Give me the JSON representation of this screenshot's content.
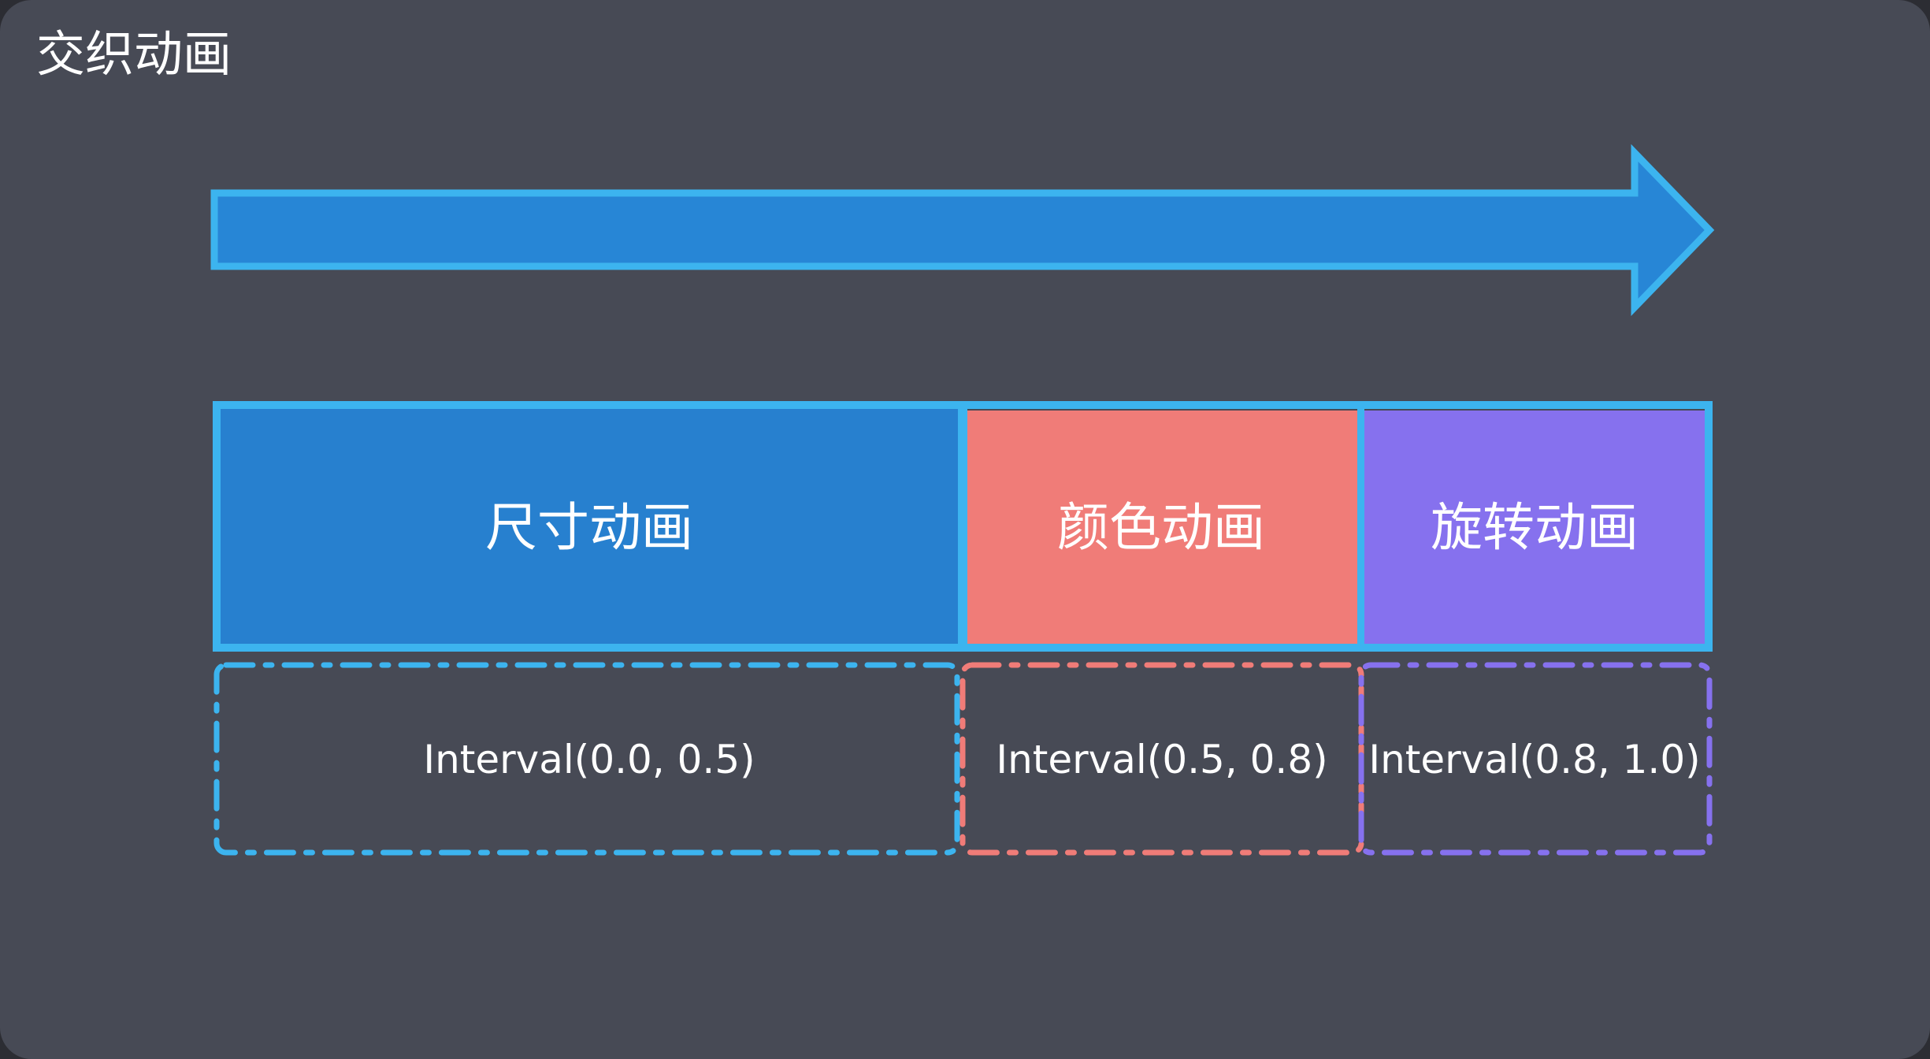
{
  "title": "交织动画",
  "colors": {
    "background": "#474a55",
    "arrow_fill": "#2786d6",
    "arrow_border": "#3cb4ef",
    "size_fill": "#2780cf",
    "color_fill": "#f07c78",
    "rotate_fill": "#8671ee",
    "frame_border": "#3cb4ef",
    "size_dash": "#3cb4ef",
    "color_dash": "#f07c78",
    "rotate_dash": "#8671ee"
  },
  "segments": [
    {
      "label": "尺寸动画",
      "interval": "Interval(0.0, 0.5)"
    },
    {
      "label": "颜色动画",
      "interval": "Interval(0.5, 0.8)"
    },
    {
      "label": "旋转动画",
      "interval": "Interval(0.8, 1.0)"
    }
  ]
}
